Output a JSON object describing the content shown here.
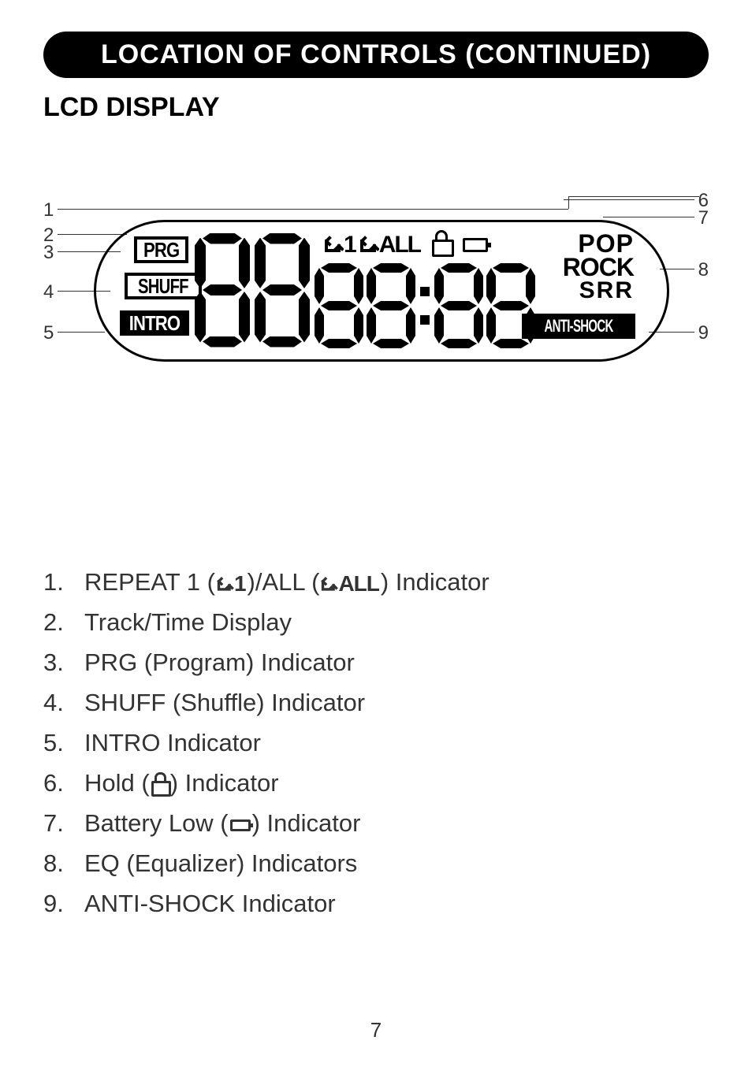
{
  "header": {
    "title": "LOCATION OF CONTROLS (CONTINUED)"
  },
  "section": {
    "title": "LCD DISPLAY"
  },
  "diagram": {
    "left_labels": [
      "1",
      "2",
      "3",
      "4",
      "5"
    ],
    "right_labels": [
      "6",
      "7",
      "8",
      "9"
    ],
    "lcd": {
      "prg": "PRG",
      "shuff": "SHUFF",
      "intro": "INTRO",
      "anti_shock": "ANTI-SHOCK",
      "repeat_1": "1",
      "repeat_all": "ALL",
      "eq_pop": "POP",
      "eq_rock": "ROCK",
      "eq_srr": "SRR",
      "track_digits": "88",
      "time_digits": "88:88"
    }
  },
  "legend": {
    "items": [
      {
        "num": "1.",
        "prefix": "REPEAT 1 (",
        "icon1": "repeat-1",
        "mid": ")/ALL (",
        "icon2": "repeat-all",
        "suffix": ") Indicator"
      },
      {
        "num": "2.",
        "text": "Track/Time Display"
      },
      {
        "num": "3.",
        "text": "PRG (Program) Indicator"
      },
      {
        "num": "4.",
        "text": "SHUFF (Shuffle) Indicator"
      },
      {
        "num": "5.",
        "text": "INTRO Indicator"
      },
      {
        "num": "6.",
        "prefix": "Hold (",
        "icon1": "lock",
        "suffix": ") Indicator"
      },
      {
        "num": "7.",
        "prefix": "Battery Low (",
        "icon1": "battery",
        "suffix": ") Indicator"
      },
      {
        "num": "8.",
        "text": "EQ (Equalizer) Indicators"
      },
      {
        "num": "9.",
        "text": "ANTI-SHOCK Indicator"
      }
    ]
  },
  "page_number": "7"
}
